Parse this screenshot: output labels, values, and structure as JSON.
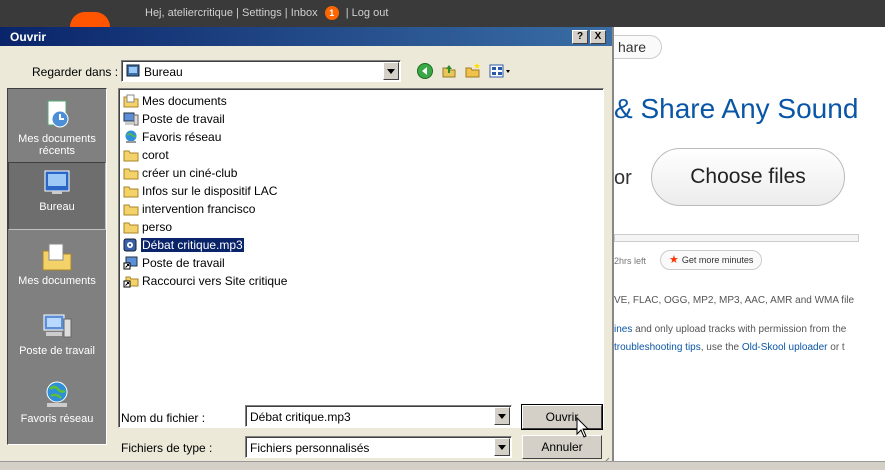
{
  "web": {
    "topbar": {
      "greeting": "Hej, ateliercritique | Settings | Inbox",
      "inbox_count": "1",
      "logout": "| Log out"
    },
    "share_button": "hare",
    "headline": "& Share Any Sound",
    "or": "or",
    "choose_files": "Choose files",
    "hrs_left": "2hrs left",
    "get_more_minutes": "Get more minutes",
    "formats": "VE, FLAC, OGG, MP2, MP3, AAC, AMR and WMA file",
    "line1_link": "ines",
    "line1_text": " and only upload tracks with permission from the",
    "line2_link": "troubleshooting tips",
    "line2_mid": ", use the ",
    "line2_link2": "Old-Skool uploader",
    "line2_end": " or t"
  },
  "dialog": {
    "title": "Ouvrir",
    "help_btn": "?",
    "close_btn": "X",
    "look_in_label": "Regarder dans :",
    "look_in_value": "Bureau",
    "places": [
      {
        "label": "Mes documents récents"
      },
      {
        "label": "Bureau"
      },
      {
        "label": "Mes documents"
      },
      {
        "label": "Poste de travail"
      },
      {
        "label": "Favoris réseau"
      }
    ],
    "files": [
      {
        "name": "Mes documents",
        "icon": "folder-docs"
      },
      {
        "name": "Poste de travail",
        "icon": "computer"
      },
      {
        "name": "Favoris réseau",
        "icon": "network"
      },
      {
        "name": "corot",
        "icon": "folder"
      },
      {
        "name": "créer un ciné-club",
        "icon": "folder"
      },
      {
        "name": "Infos sur le dispositif LAC",
        "icon": "folder"
      },
      {
        "name": "intervention francisco",
        "icon": "folder"
      },
      {
        "name": "perso",
        "icon": "folder"
      },
      {
        "name": "Débat critique.mp3",
        "icon": "audio"
      },
      {
        "name": "Poste de travail",
        "icon": "shortcut"
      },
      {
        "name": "Raccourci vers Site critique",
        "icon": "shortcut"
      }
    ],
    "filename_label": "Nom du fichier :",
    "filename_value": "Débat critique.mp3",
    "filetype_label": "Fichiers de type :",
    "filetype_value": "Fichiers personnalisés",
    "open_btn": "Ouvrir",
    "cancel_btn": "Annuler"
  }
}
